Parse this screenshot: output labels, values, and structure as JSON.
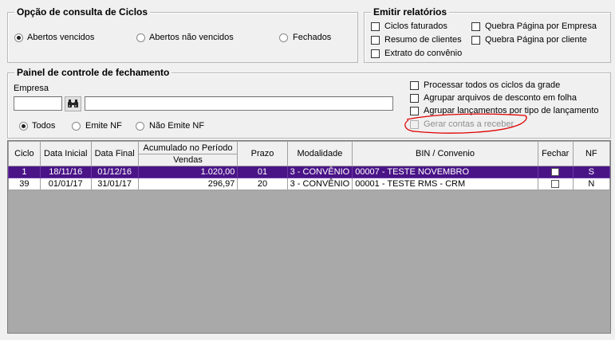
{
  "opcao_ciclos": {
    "title": "Opção de consulta de Ciclos",
    "options": [
      {
        "label": "Abertos vencidos",
        "selected": true
      },
      {
        "label": "Abertos não vencidos",
        "selected": false
      },
      {
        "label": "Fechados",
        "selected": false
      }
    ]
  },
  "emitir_relatorios": {
    "title": "Emitir relatórios",
    "options": [
      {
        "label": "Ciclos faturados",
        "checked": false
      },
      {
        "label": "Resumo de clientes",
        "checked": false
      },
      {
        "label": "Extrato do convênio",
        "checked": false
      },
      {
        "label": "Quebra Página por Empresa",
        "checked": false
      },
      {
        "label": "Quebra Página por cliente",
        "checked": false
      }
    ]
  },
  "painel": {
    "title": "Painel de controle de fechamento",
    "empresa_label": "Empresa",
    "empresa_code": "",
    "empresa_name": "",
    "search_icon": "binoculars-icon",
    "nf_filter": [
      {
        "label": "Todos",
        "selected": true
      },
      {
        "label": "Emite NF",
        "selected": false
      },
      {
        "label": "Não Emite NF",
        "selected": false
      }
    ],
    "options": [
      {
        "label": "Processar todos os ciclos da grade",
        "checked": false,
        "enabled": true
      },
      {
        "label": "Agrupar arquivos de desconto em folha",
        "checked": false,
        "enabled": true
      },
      {
        "label": "Agrupar lançamentos por tipo de lançamento",
        "checked": false,
        "enabled": true
      },
      {
        "label": "Gerar contas a receber",
        "checked": false,
        "enabled": false
      }
    ],
    "annotation_color": "#e00000"
  },
  "grid": {
    "headers": {
      "ciclo": "Ciclo",
      "data_inicial": "Data Inicial",
      "data_final": "Data Final",
      "acumulado": "Acumulado no Período",
      "vendas": "Vendas",
      "prazo": "Prazo",
      "modalidade": "Modalidade",
      "bin": "BIN / Convenio",
      "fechar": "Fechar",
      "nf": "NF"
    },
    "rows": [
      {
        "ciclo": "1",
        "data_inicial": "18/11/16",
        "data_final": "01/12/16",
        "vendas": "1.020,00",
        "prazo": "01",
        "modalidade": "3 - CONVÊNIO",
        "bin": "00007 - TESTE NOVEMBRO",
        "fechar": false,
        "nf": "S",
        "selected": true
      },
      {
        "ciclo": "39",
        "data_inicial": "01/01/17",
        "data_final": "31/01/17",
        "vendas": "296,97",
        "prazo": "20",
        "modalidade": "3 - CONVÊNIO",
        "bin": "00001 - TESTE RMS - CRM",
        "fechar": false,
        "nf": "N",
        "selected": false
      }
    ],
    "selection_color": "#4a1487"
  }
}
